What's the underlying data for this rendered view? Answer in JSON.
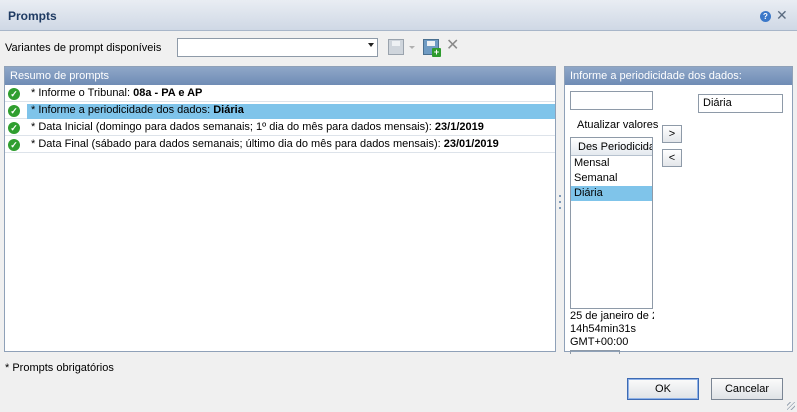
{
  "dialog": {
    "title": "Prompts",
    "help_icon": "help-icon",
    "close_icon": "close-icon"
  },
  "variants": {
    "label": "Variantes de prompt disponíveis",
    "selected": ""
  },
  "summary": {
    "header": "Resumo de prompts",
    "rows": [
      {
        "prefix": "* Informe o Tribunal: ",
        "value": "08a - PA e AP",
        "selected": false
      },
      {
        "prefix": "* Informe a periodicidade dos dados: ",
        "value": "Diária",
        "selected": true
      },
      {
        "prefix": "* Data Inicial (domingo para dados semanais; 1º dia do mês para dados mensais): ",
        "value": "23/1/2019",
        "selected": false
      },
      {
        "prefix": "* Data Final (sábado para dados semanais; último dia do mês para dados mensais): ",
        "value": "23/01/2019",
        "selected": false
      }
    ]
  },
  "periodicity": {
    "header": "Informe a periodicidade dos dados:",
    "search_value": "",
    "selected_value": "Diária",
    "refresh_label": "Atualizar valores",
    "list_header": "Des Periodicidade",
    "options": [
      "Mensal",
      "Semanal",
      "Diária"
    ],
    "selected_option": "Diária",
    "add_label": ">",
    "remove_label": "<",
    "timestamp_lines": [
      "25 de janeiro de 2",
      "14h54min31s",
      "GMT+00:00"
    ]
  },
  "footer": {
    "note": "* Prompts obrigatórios",
    "ok_label": "OK",
    "cancel_label": "Cancelar"
  }
}
